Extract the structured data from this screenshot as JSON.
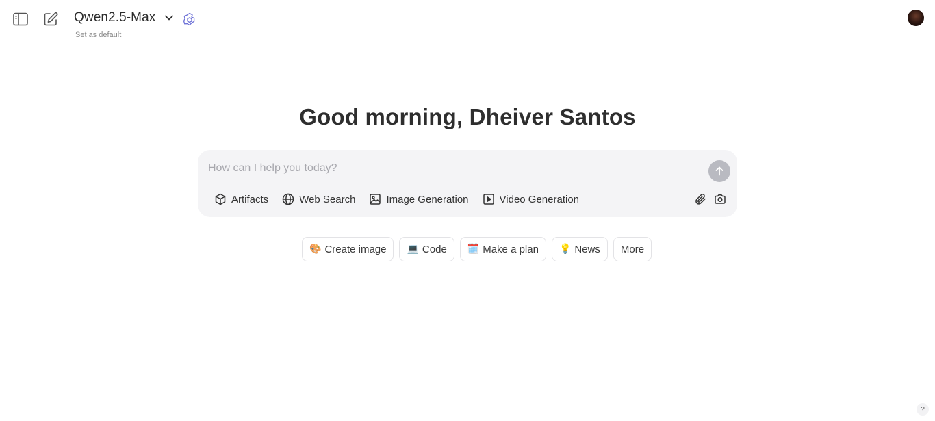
{
  "header": {
    "sidebar_toggle_icon": "sidebar-icon",
    "new_chat_icon": "edit-icon",
    "model_name": "Qwen2.5-Max",
    "model_dropdown_icon": "chevron-down-icon",
    "model_badge_icon": "qwen-logo-icon",
    "set_default_label": "Set as default",
    "avatar_icon": "user-avatar"
  },
  "main": {
    "greeting": "Good morning, Dheiver Santos"
  },
  "composer": {
    "placeholder": "How can I help you today?",
    "value": "",
    "send_icon": "arrow-up-icon",
    "tools": [
      {
        "label": "Artifacts",
        "icon": "cube-icon"
      },
      {
        "label": "Web Search",
        "icon": "globe-icon"
      },
      {
        "label": "Image Generation",
        "icon": "image-icon"
      },
      {
        "label": "Video Generation",
        "icon": "play-square-icon"
      }
    ],
    "attach_icon": "paperclip-icon",
    "camera_icon": "camera-icon"
  },
  "suggestions": [
    {
      "emoji": "🎨",
      "label": "Create image"
    },
    {
      "emoji": "💻",
      "label": "Code"
    },
    {
      "emoji": "🗓️",
      "label": "Make a plan"
    },
    {
      "emoji": "💡",
      "label": "News"
    },
    {
      "emoji": "",
      "label": "More"
    }
  ],
  "help": {
    "label": "?"
  },
  "colors": {
    "composer_bg": "#f4f4f6",
    "send_disabled": "#b9bac1",
    "badge_accent": "#6b6fd6"
  }
}
